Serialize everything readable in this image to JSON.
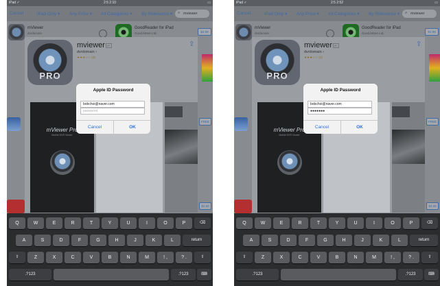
{
  "screens": [
    {
      "status": {
        "carrier": "iPad ✓",
        "time": "2:5 2:10",
        "battery": "▭"
      },
      "nav": {
        "cancel": "Cancel",
        "ipad_only": "iPad Only ▾",
        "price": "Any Price ▾",
        "categories": "All Categories ▾",
        "relevance": "By Relevance ▾",
        "search_value": "mviewer"
      },
      "list": {
        "app1": {
          "name": "mViewer",
          "developer": "dvrdomain",
          "stars": "★★★☆☆ (3)"
        },
        "app2": {
          "name": "GoodReader for iPad",
          "developer": "Good.iWare Ltd.",
          "stars": "★★★★☆ (444)",
          "price": "$4.99"
        },
        "free_label": "FREE",
        "price2": "$4.99"
      },
      "detail": {
        "title": "mviewer",
        "age": "4+",
        "developer": "dvrdomain ›",
        "stars": "★★★☆☆ (4)",
        "pro": "PRO",
        "shot_title": "mViewer Pro",
        "shot_sub": "Mobile DVR Viewer"
      },
      "dialog": {
        "title": "Apple ID Password",
        "username": "bobchoi@naver.com",
        "password_placeholder": "password",
        "password_value": "",
        "cancel": "Cancel",
        "ok": "OK"
      }
    },
    {
      "status": {
        "carrier": "iPad ✓",
        "time": "2:5 2:52",
        "battery": "▭"
      },
      "nav": {
        "cancel": "Cancel",
        "ipad_only": "iPad Only ▾",
        "price": "Any Price ▾",
        "categories": "All Categories ▾",
        "relevance": "By Relevance ▾",
        "search_value": "mviewer"
      },
      "list": {
        "app1": {
          "name": "mViewer",
          "developer": "dvrdomain",
          "stars": "★★★☆☆ (3)"
        },
        "app2": {
          "name": "GoodReader for iPad",
          "developer": "Good.iWare Ltd.",
          "stars": "★★★★☆ (444)",
          "price": "$4.99"
        },
        "free_label": "FREE",
        "price2": "$4.99"
      },
      "detail": {
        "title": "mviewer",
        "age": "4+",
        "developer": "dvrdomain ›",
        "stars": "★★★☆☆ (4)",
        "pro": "PRO",
        "shot_title": "mViewer Pro",
        "shot_sub": "Mobile DVR Viewer"
      },
      "dialog": {
        "title": "Apple ID Password",
        "username": "bobchoi@naver.com",
        "password_placeholder": "",
        "password_value": "●●●●●●●",
        "cancel": "Cancel",
        "ok": "OK"
      }
    }
  ],
  "keyboard": {
    "row1": [
      "Q",
      "W",
      "E",
      "R",
      "T",
      "Y",
      "U",
      "I",
      "O",
      "P",
      "⌫"
    ],
    "row2": [
      "A",
      "S",
      "D",
      "F",
      "G",
      "H",
      "J",
      "K",
      "L",
      "return"
    ],
    "row3": [
      "⇧",
      "Z",
      "X",
      "C",
      "V",
      "B",
      "N",
      "M",
      "!\n,",
      "?\n.",
      "⇧"
    ],
    "row4": [
      ".?123",
      "",
      ".?123",
      "⌨"
    ]
  }
}
